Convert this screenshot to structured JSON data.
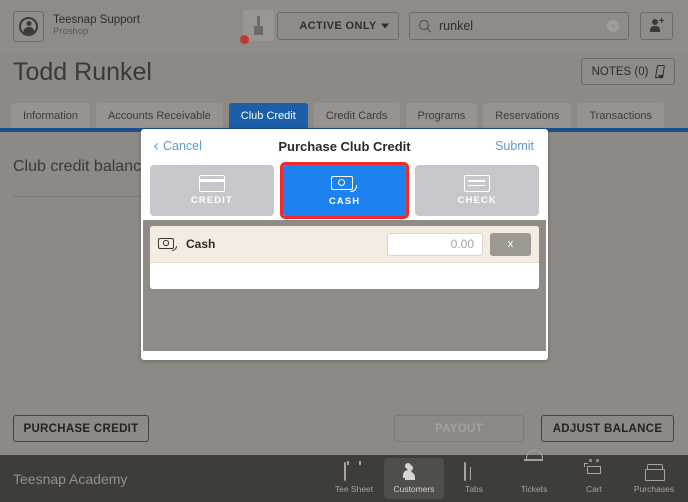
{
  "topbar": {
    "account_name": "Teesnap Support",
    "account_role": "Proshop",
    "avatar_icon": "user-circle-icon",
    "notification_icon": "thermometer-icon",
    "notification_badge": "",
    "filter_label": "ACTIVE ONLY",
    "filter_caret_icon": "chevron-down-icon",
    "search_icon": "search-icon",
    "search_value": "runkel",
    "search_placeholder": "Search",
    "search_clear_label": "×",
    "add_user_icon": "add-user-icon"
  },
  "page": {
    "title": "Todd Runkel",
    "notes_label": "NOTES (0)",
    "notes_icon": "pencil-icon",
    "balance_label": "Club credit balance"
  },
  "tabs": [
    {
      "label": "Information",
      "active": false
    },
    {
      "label": "Accounts Receivable",
      "active": false
    },
    {
      "label": "Club Credit",
      "active": true
    },
    {
      "label": "Credit Cards",
      "active": false
    },
    {
      "label": "Programs",
      "active": false
    },
    {
      "label": "Reservations",
      "active": false
    },
    {
      "label": "Transactions",
      "active": false
    }
  ],
  "modal": {
    "cancel_label": "Cancel",
    "back_icon": "chevron-left-icon",
    "title": "Purchase Club Credit",
    "submit_label": "Submit",
    "methods": [
      {
        "label": "CREDIT",
        "icon": "credit-card-icon",
        "selected": false,
        "highlighted": false
      },
      {
        "label": "CASH",
        "icon": "cash-icon",
        "selected": true,
        "highlighted": true
      },
      {
        "label": "CHECK",
        "icon": "check-icon",
        "selected": false,
        "highlighted": false
      }
    ],
    "entry": {
      "icon": "cash-icon",
      "name": "Cash",
      "amount_value": "0.00",
      "amount_placeholder": "0.00",
      "remove_label": "x"
    },
    "highlight_color": "#ef2b2b",
    "selected_color": "#1d82f0"
  },
  "actions": {
    "purchase_credit_label": "PURCHASE CREDIT",
    "payout_label": "PAYOUT",
    "adjust_balance_label": "ADJUST BALANCE"
  },
  "bottomnav": {
    "brand": "Teesnap Academy",
    "items": [
      {
        "label": "Tee Sheet",
        "icon": "tee-sheet-icon",
        "active": false
      },
      {
        "label": "Customers",
        "icon": "customers-icon",
        "active": true
      },
      {
        "label": "Tabs",
        "icon": "tabs-icon",
        "active": false
      },
      {
        "label": "Tickets",
        "icon": "tickets-icon",
        "active": false
      },
      {
        "label": "Cart",
        "icon": "cart-icon",
        "active": false
      },
      {
        "label": "Purchases",
        "icon": "purchases-icon",
        "active": false
      }
    ]
  }
}
